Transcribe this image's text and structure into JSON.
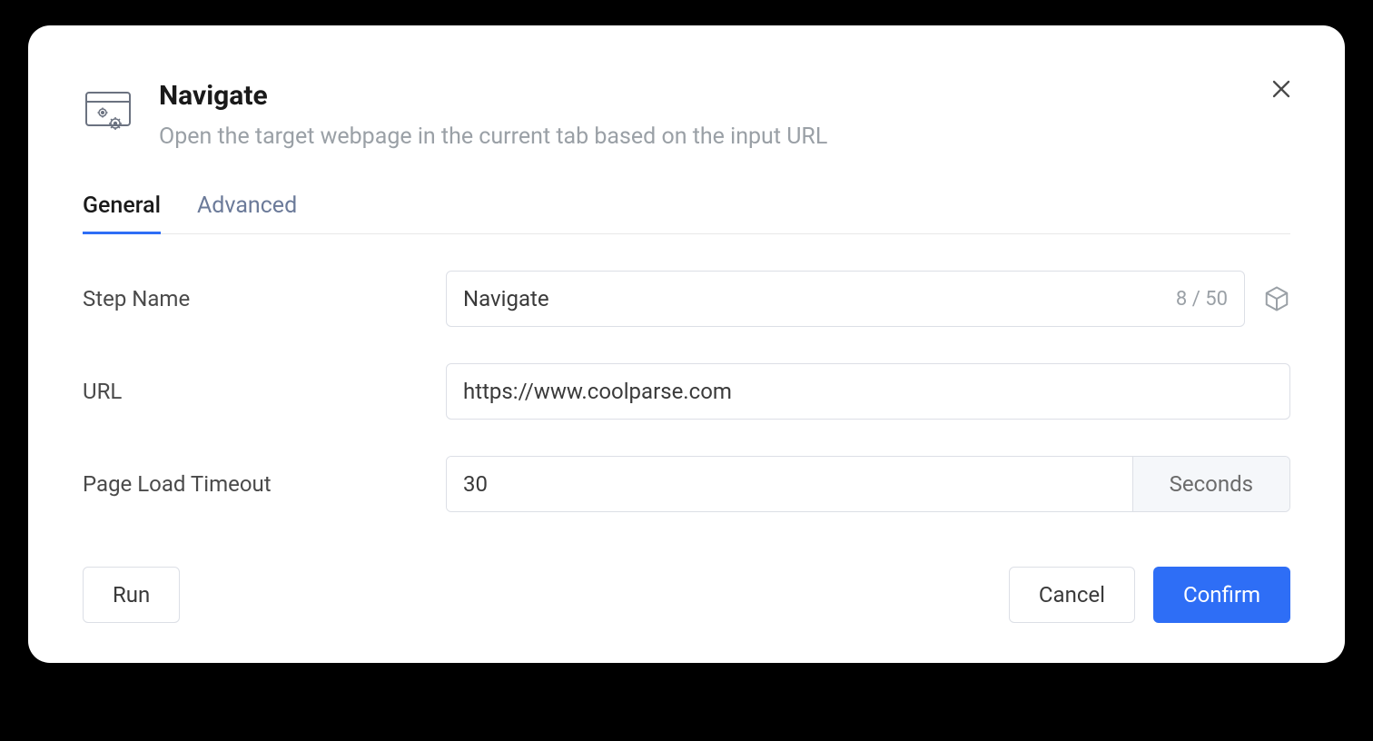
{
  "header": {
    "title": "Navigate",
    "subtitle": "Open the target webpage in the current tab based on the input URL"
  },
  "tabs": {
    "general": "General",
    "advanced": "Advanced"
  },
  "form": {
    "step_name": {
      "label": "Step Name",
      "value": "Navigate",
      "count": "8 / 50"
    },
    "url": {
      "label": "URL",
      "value": "https://www.coolparse.com"
    },
    "timeout": {
      "label": "Page Load Timeout",
      "value": "30",
      "unit": "Seconds"
    }
  },
  "footer": {
    "run": "Run",
    "cancel": "Cancel",
    "confirm": "Confirm"
  }
}
